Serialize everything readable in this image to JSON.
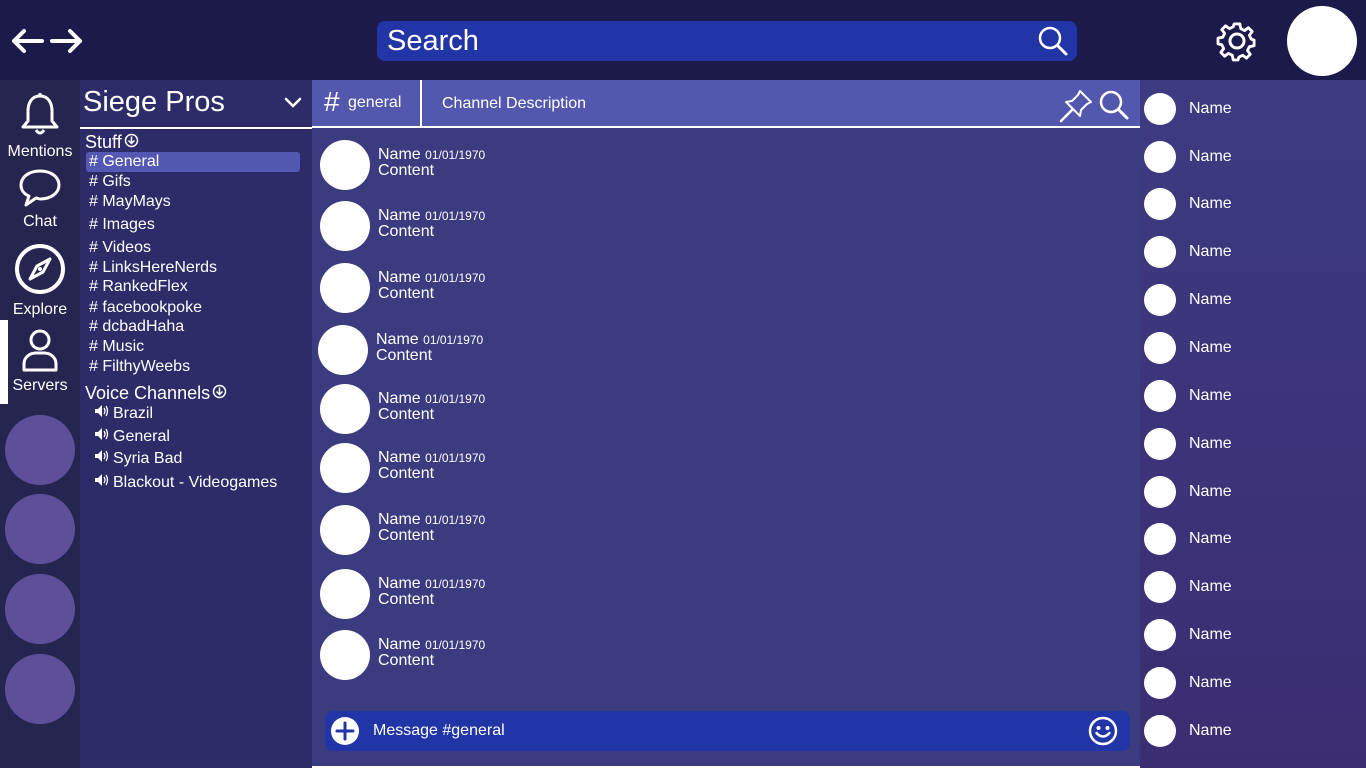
{
  "search": {
    "placeholder": "Search"
  },
  "rail": {
    "items": [
      {
        "label": "Mentions",
        "icon": "bell-icon"
      },
      {
        "label": "Chat",
        "icon": "chat-bubble-icon"
      },
      {
        "label": "Explore",
        "icon": "compass-icon"
      },
      {
        "label": "Servers",
        "icon": "user-icon"
      }
    ],
    "active": "Servers"
  },
  "server": {
    "name": "Siege Pros",
    "categories": [
      {
        "name": "Stuff",
        "channels": [
          "# General",
          "# Gifs",
          "# MayMays",
          "# Images",
          "# Videos",
          "# LinksHereNerds",
          "# RankedFlex",
          "# facebookpoke",
          "# dcbadHaha",
          "# Music",
          "# FilthyWeebs"
        ]
      },
      {
        "name": "Voice Channels",
        "channels": [
          "Brazil",
          "General",
          "Syria Bad",
          "Blackout - Videogames"
        ]
      }
    ],
    "active_channel": "# General"
  },
  "channel": {
    "hash": "#",
    "name": "general",
    "description": "Channel Description"
  },
  "messages": [
    {
      "name": "Name",
      "date": "01/01/1970",
      "content": "Content"
    },
    {
      "name": "Name",
      "date": "01/01/1970",
      "content": "Content"
    },
    {
      "name": "Name",
      "date": "01/01/1970",
      "content": "Content"
    },
    {
      "name": "Name",
      "date": "01/01/1970",
      "content": "Content"
    },
    {
      "name": "Name",
      "date": "01/01/1970",
      "content": "Content"
    },
    {
      "name": "Name",
      "date": "01/01/1970",
      "content": "Content"
    },
    {
      "name": "Name",
      "date": "01/01/1970",
      "content": "Content"
    },
    {
      "name": "Name",
      "date": "01/01/1970",
      "content": "Content"
    },
    {
      "name": "Name",
      "date": "01/01/1970",
      "content": "Content"
    }
  ],
  "composer": {
    "placeholder": "Message #general"
  },
  "members": [
    "Name",
    "Name",
    "Name",
    "Name",
    "Name",
    "Name",
    "Name",
    "Name",
    "Name",
    "Name",
    "Name",
    "Name",
    "Name",
    "Name"
  ],
  "colors": {
    "topbar": "#1b1a4a",
    "accent_blue": "#2235a6",
    "active_channel": "#5458b2",
    "header": "#5357ad",
    "chat_bg": "#3b3b7f",
    "server_circle": "#5d4f9a"
  }
}
